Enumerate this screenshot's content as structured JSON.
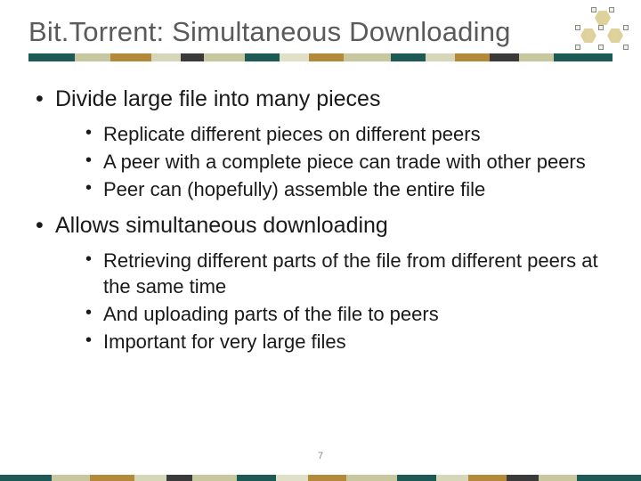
{
  "title": "Bit.Torrent: Simultaneous Downloading",
  "bullets": {
    "b1": "Divide large file into many pieces",
    "b1_sub": {
      "s1": "Replicate different pieces on different peers",
      "s2": "A peer with a complete piece can trade with other peers",
      "s3": "Peer can (hopefully) assemble the entire file"
    },
    "b2": "Allows simultaneous downloading",
    "b2_sub": {
      "s1": "Retrieving different parts of the file from different peers at the same time",
      "s2": "And uploading parts of the file to peers",
      "s3": "Important for very large files"
    }
  },
  "page_number": "7"
}
